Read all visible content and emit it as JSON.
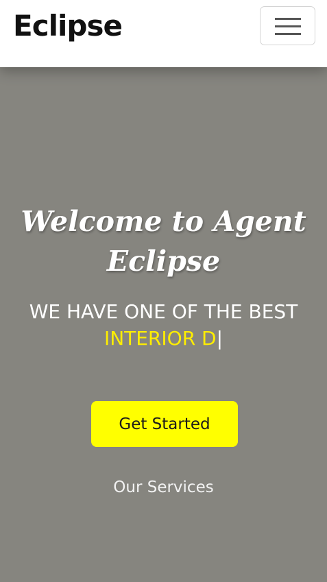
{
  "navbar": {
    "brand": "Eclipse",
    "toggle_icon": "hamburger-menu-icon"
  },
  "hero": {
    "title": "Welcome to Agent Eclipse",
    "tagline": "WE HAVE ONE OF THE BEST",
    "typed_text": "INTERIOR D",
    "cursor": "|",
    "cta_label": "Get Started",
    "services_link": "Our Services"
  },
  "colors": {
    "hero_background": "#86857f",
    "accent": "#ffff00",
    "typed_text": "#ffee00"
  }
}
